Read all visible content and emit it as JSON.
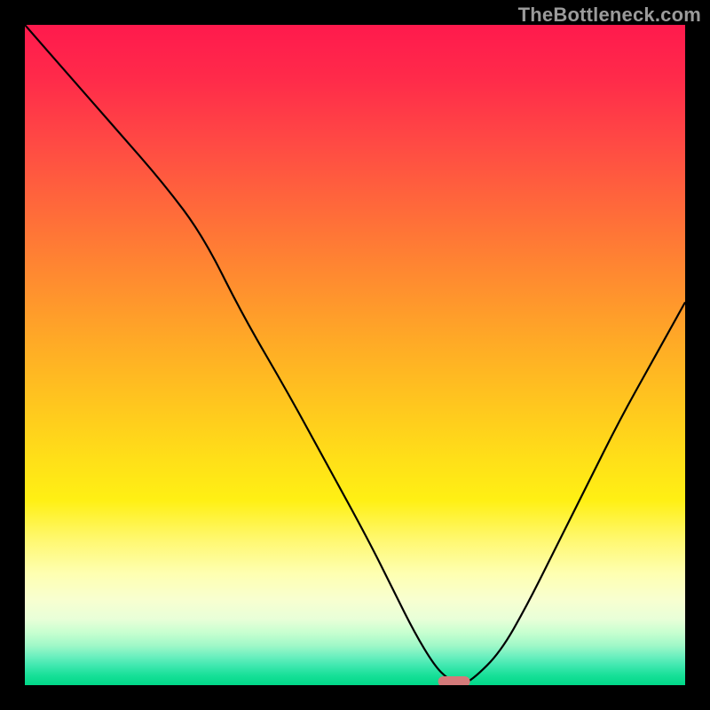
{
  "watermark": "TheBottleneck.com",
  "chart_data": {
    "type": "line",
    "title": "",
    "xlabel": "",
    "ylabel": "",
    "xlim": [
      0,
      100
    ],
    "ylim": [
      0,
      100
    ],
    "grid": false,
    "legend": false,
    "series": [
      {
        "name": "bottleneck-curve",
        "x": [
          0,
          7,
          14,
          21,
          27,
          33,
          40,
          46,
          52,
          56,
          59,
          62,
          64,
          66,
          68,
          72,
          76,
          80,
          85,
          90,
          95,
          100
        ],
        "values": [
          100,
          92,
          84,
          76,
          68,
          56,
          44,
          33,
          22,
          14,
          8,
          3,
          1,
          0,
          1,
          5,
          12,
          20,
          30,
          40,
          49,
          58
        ]
      }
    ],
    "marker": {
      "x": 65,
      "y": 0,
      "color": "#d47a7a",
      "shape": "pill"
    },
    "background_gradient": [
      {
        "stop": 0.0,
        "color": "#ff1a4d"
      },
      {
        "stop": 0.5,
        "color": "#ffc81e"
      },
      {
        "stop": 0.8,
        "color": "#feffb0"
      },
      {
        "stop": 0.95,
        "color": "#70f0c0"
      },
      {
        "stop": 1.0,
        "color": "#00d888"
      }
    ]
  }
}
